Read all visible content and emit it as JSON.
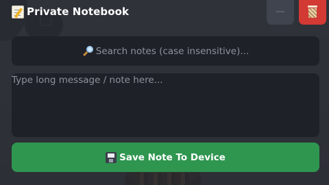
{
  "notebook": {
    "title": "Private Notebook",
    "title_icon": "memo-icon",
    "minimize_icon": "minimize-icon",
    "delete_icon": "wastebasket-icon",
    "search": {
      "icon": "magnifying-glass-icon",
      "placeholder": "Search notes (case insensitive)..."
    },
    "note_input": {
      "placeholder": "Type long message / note here...",
      "value": ""
    },
    "save_button": {
      "icon": "floppy-disk-icon",
      "label": "Save Note To Device"
    }
  },
  "background": {
    "cart_icon": "shopping-cart-icon"
  },
  "colors": {
    "panel": "#282a31",
    "field": "#1f2128",
    "save_button": "#2f9650",
    "delete_button": "#d23a33",
    "minimize_button": "#40444f",
    "placeholder_text": "#8d929c",
    "title_text": "#ffffff"
  }
}
